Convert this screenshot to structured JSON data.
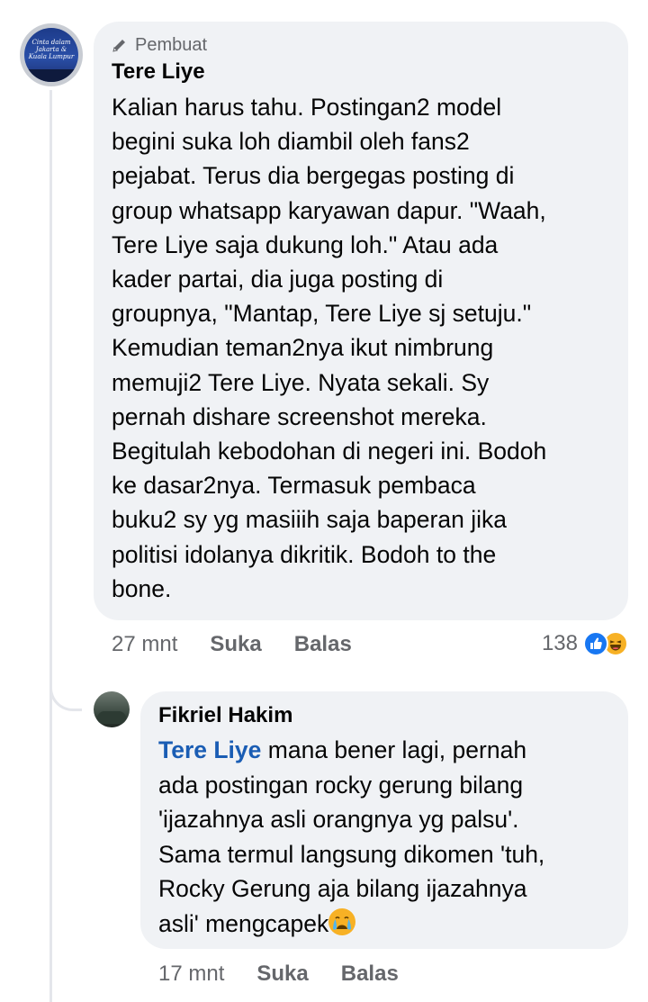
{
  "main_comment": {
    "avatar_label": "Cinta dalam Jakarta & Kuala Lumpur",
    "creator_badge": "Pembuat",
    "author": "Tere Liye",
    "text_lines": [
      "Kalian harus tahu. Postingan2 model",
      "begini suka loh diambil oleh fans2",
      "pejabat. Terus dia bergegas posting di",
      "group whatsapp karyawan dapur. \"Waah,",
      "Tere Liye saja dukung loh.\" Atau ada",
      "kader partai, dia juga posting di",
      "groupnya, \"Mantap, Tere Liye sj setuju.\"",
      "Kemudian teman2nya ikut nimbrung",
      "memuji2 Tere Liye. Nyata sekali. Sy",
      "pernah dishare screenshot mereka.",
      "Begitulah kebodohan di negeri ini. Bodoh",
      "ke dasar2nya. Termasuk pembaca",
      "buku2 sy yg masiiih saja baperan jika",
      "politisi idolanya dikritik. Bodoh to the",
      "bone."
    ],
    "time": "27 mnt",
    "like_label": "Suka",
    "reply_label": "Balas",
    "reaction_count": "138",
    "reactions": [
      "like-icon",
      "haha-icon"
    ]
  },
  "reply_comment": {
    "author": "Fikriel Hakim",
    "mention": "Tere Liye",
    "line1_rest": " mana bener lagi, pernah",
    "text_lines": [
      "ada postingan rocky gerung bilang",
      "'ijazahnya asli orangnya yg palsu'.",
      "Sama termul langsung dikomen 'tuh,",
      "Rocky Gerung aja bilang ijazahnya"
    ],
    "last_line": "asli' mengcapek",
    "trailing_emoji": "crying-face-icon",
    "time": "17 mnt",
    "like_label": "Suka",
    "reply_label": "Balas"
  },
  "colors": {
    "bubble": "#f0f2f5",
    "meta_text": "#65676b",
    "mention": "#1a5db4",
    "like_blue": "#1877f2",
    "emoji_yellow": "#f7b125",
    "thread_line": "#e4e6eb"
  }
}
